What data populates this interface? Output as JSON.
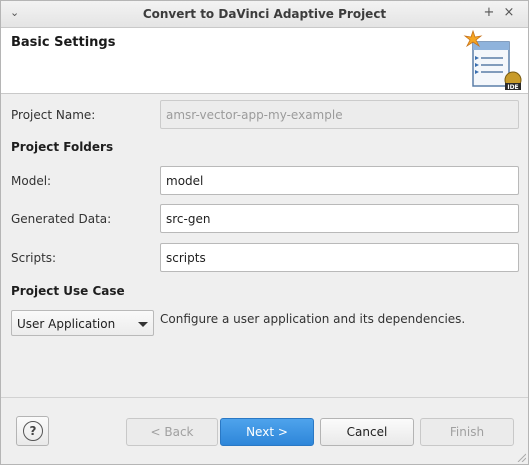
{
  "window": {
    "title": "Convert to DaVinci Adaptive Project",
    "menu_glyph": "⌄",
    "maximize_glyph": "+",
    "close_glyph": "×"
  },
  "banner": {
    "heading": "Basic Settings",
    "icon": "wizard-document-icon"
  },
  "form": {
    "project_name_label": "Project Name:",
    "project_name_value": "amsr-vector-app-my-example",
    "folders_section": "Project Folders",
    "model_label": "Model:",
    "model_value": "model",
    "generated_label": "Generated Data:",
    "generated_value": "src-gen",
    "scripts_label": "Scripts:",
    "scripts_value": "scripts",
    "use_case_section": "Project Use Case",
    "use_case_selected": "User Application",
    "use_case_description": "Configure a user application and its dependencies."
  },
  "buttons": {
    "help_glyph": "?",
    "back": "< Back",
    "next": "Next >",
    "cancel": "Cancel",
    "finish": "Finish"
  },
  "colors": {
    "primary": "#2e86d9",
    "banner_bg": "#ffffff",
    "dialog_bg": "#efefef"
  }
}
